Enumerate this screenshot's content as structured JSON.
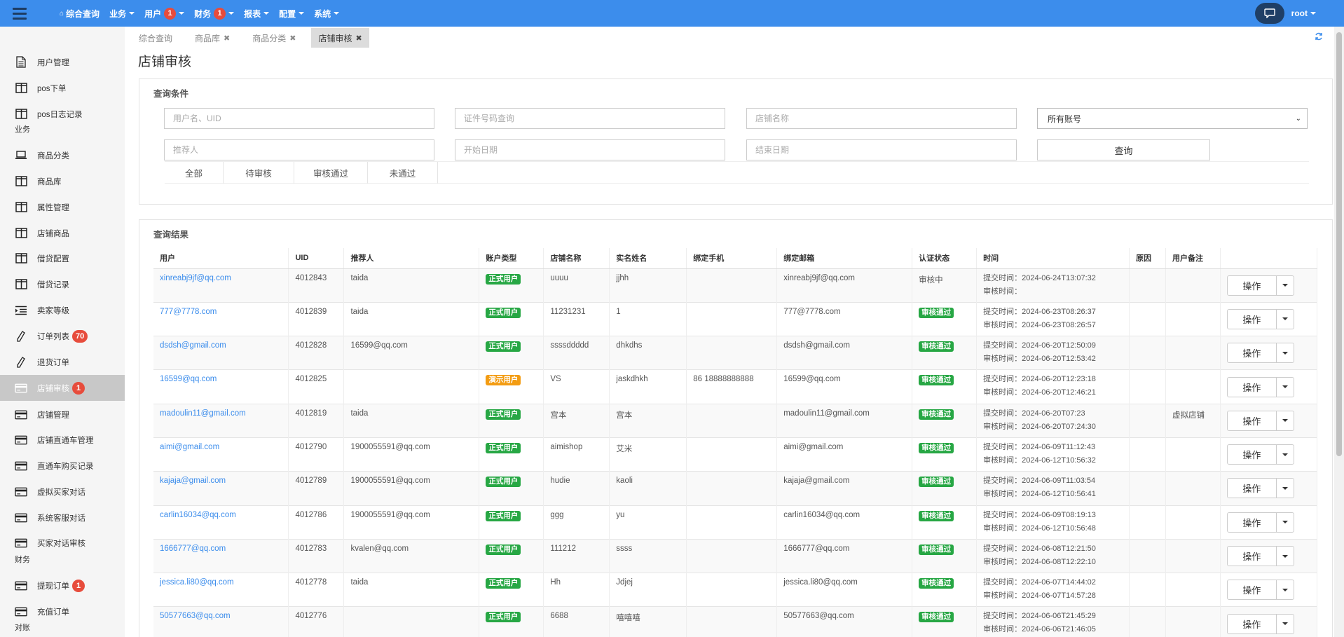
{
  "topnav": {
    "items": [
      {
        "label": "综合查询",
        "home": true,
        "caret": false,
        "badge": null
      },
      {
        "label": "业务",
        "home": false,
        "caret": true,
        "badge": null
      },
      {
        "label": "用户",
        "home": false,
        "caret": true,
        "badge": "1"
      },
      {
        "label": "财务",
        "home": false,
        "caret": true,
        "badge": "1"
      },
      {
        "label": "报表",
        "home": false,
        "caret": true,
        "badge": null
      },
      {
        "label": "配置",
        "home": false,
        "caret": true,
        "badge": null
      },
      {
        "label": "系统",
        "home": false,
        "caret": true,
        "badge": null
      }
    ],
    "user": "root"
  },
  "sidebar": {
    "sections": [
      {
        "label": "业务"
      },
      {
        "label": "财务"
      },
      {
        "label": "对账"
      }
    ],
    "items": [
      {
        "label": "用户管理",
        "icon": "document-icon",
        "badge": null,
        "active": false
      },
      {
        "label": "pos下单",
        "icon": "columns-icon",
        "badge": null,
        "active": false
      },
      {
        "label": "pos日志记录",
        "icon": "columns-icon",
        "badge": null,
        "active": false
      },
      {
        "label": "商品分类",
        "icon": "laptop-icon",
        "badge": null,
        "active": false
      },
      {
        "label": "商品库",
        "icon": "columns-icon",
        "badge": null,
        "active": false
      },
      {
        "label": "属性管理",
        "icon": "columns-icon",
        "badge": null,
        "active": false
      },
      {
        "label": "店铺商品",
        "icon": "columns-icon",
        "badge": null,
        "active": false
      },
      {
        "label": "借贷配置",
        "icon": "columns-icon",
        "badge": null,
        "active": false
      },
      {
        "label": "借贷记录",
        "icon": "columns-icon",
        "badge": null,
        "active": false
      },
      {
        "label": "卖家等级",
        "icon": "indent-icon",
        "badge": null,
        "active": false
      },
      {
        "label": "订单列表",
        "icon": "pencil-icon",
        "badge": "70",
        "active": false
      },
      {
        "label": "退货订单",
        "icon": "pencil-icon",
        "badge": null,
        "active": false
      },
      {
        "label": "店铺审核",
        "icon": "card-icon",
        "badge": "1",
        "active": true
      },
      {
        "label": "店铺管理",
        "icon": "card-icon",
        "badge": null,
        "active": false
      },
      {
        "label": "店铺直通车管理",
        "icon": "card-icon",
        "badge": null,
        "active": false
      },
      {
        "label": "直通车购买记录",
        "icon": "card-icon",
        "badge": null,
        "active": false
      },
      {
        "label": "虚拟买家对话",
        "icon": "card-icon",
        "badge": null,
        "active": false
      },
      {
        "label": "系统客服对话",
        "icon": "card-icon",
        "badge": null,
        "active": false
      },
      {
        "label": "买家对话审核",
        "icon": "card-icon",
        "badge": null,
        "active": false
      },
      {
        "label": "提现订单",
        "icon": "card-icon",
        "badge": "1",
        "active": false
      },
      {
        "label": "充值订单",
        "icon": "card-icon",
        "badge": null,
        "active": false
      }
    ]
  },
  "tabs": [
    {
      "label": "综合查询",
      "closable": false,
      "active": false
    },
    {
      "label": "商品库",
      "closable": true,
      "active": false
    },
    {
      "label": "商品分类",
      "closable": true,
      "active": false
    },
    {
      "label": "店铺审核",
      "closable": true,
      "active": true
    }
  ],
  "page_title": "店铺审核",
  "query": {
    "title": "查询条件",
    "placeholders": {
      "user": "用户名、UID",
      "id_number": "证件号码查询",
      "shop_name": "店铺名称",
      "referrer": "推荐人",
      "start_date": "开始日期",
      "end_date": "结束日期"
    },
    "account_select": "所有账号",
    "query_button": "查询",
    "filter_tabs": [
      "全部",
      "待审核",
      "审核通过",
      "未通过"
    ]
  },
  "results": {
    "title": "查询结果",
    "columns": [
      "用户",
      "UID",
      "推荐人",
      "账户类型",
      "店铺名称",
      "实名姓名",
      "绑定手机",
      "绑定邮箱",
      "认证状态",
      "时间",
      "原因",
      "用户备注",
      ""
    ],
    "submit_prefix": "提交时间：",
    "review_prefix": "审核时间：",
    "action_label": "操作",
    "rows": [
      {
        "user": "xinreabj9jf@qq.com",
        "uid": "4012843",
        "referrer": "taida",
        "account_type": "正式用户",
        "account_color": "green",
        "shop": "uuuu",
        "real_name": "jjhh",
        "phone": "",
        "email": "xinreabj9jf@qq.com",
        "status": "审核中",
        "status_pill": false,
        "submit_time": "2024-06-24T13:07:32",
        "review_time": "",
        "reason": "",
        "remark": ""
      },
      {
        "user": "777@7778.com",
        "uid": "4012839",
        "referrer": "taida",
        "account_type": "正式用户",
        "account_color": "green",
        "shop": "11231231",
        "real_name": "1",
        "phone": "",
        "email": "777@7778.com",
        "status": "审核通过",
        "status_pill": true,
        "submit_time": "2024-06-23T08:26:37",
        "review_time": "2024-06-23T08:26:57",
        "reason": "",
        "remark": ""
      },
      {
        "user": "dsdsh@gmail.com",
        "uid": "4012828",
        "referrer": "16599@qq.com",
        "account_type": "正式用户",
        "account_color": "green",
        "shop": "ssssddddd",
        "real_name": "dhkdhs",
        "phone": "",
        "email": "dsdsh@gmail.com",
        "status": "审核通过",
        "status_pill": true,
        "submit_time": "2024-06-20T12:50:09",
        "review_time": "2024-06-20T12:53:42",
        "reason": "",
        "remark": ""
      },
      {
        "user": "16599@qq.com",
        "uid": "4012825",
        "referrer": "",
        "account_type": "演示用户",
        "account_color": "orange",
        "shop": "VS",
        "real_name": "jaskdhkh",
        "phone": "86 18888888888",
        "email": "16599@qq.com",
        "status": "审核通过",
        "status_pill": true,
        "submit_time": "2024-06-20T12:23:18",
        "review_time": "2024-06-20T12:46:21",
        "reason": "",
        "remark": ""
      },
      {
        "user": "madoulin11@gmail.com",
        "uid": "4012819",
        "referrer": "taida",
        "account_type": "正式用户",
        "account_color": "green",
        "shop": "宫本",
        "real_name": "宫本",
        "phone": "",
        "email": "madoulin11@gmail.com",
        "status": "审核通过",
        "status_pill": true,
        "submit_time": "2024-06-20T07:23",
        "review_time": "2024-06-20T07:24:30",
        "reason": "",
        "remark": "虚拟店铺"
      },
      {
        "user": "aimi@gmail.com",
        "uid": "4012790",
        "referrer": "1900055591@qq.com",
        "account_type": "正式用户",
        "account_color": "green",
        "shop": "aimishop",
        "real_name": "艾米",
        "phone": "",
        "email": "aimi@gmail.com",
        "status": "审核通过",
        "status_pill": true,
        "submit_time": "2024-06-09T11:12:43",
        "review_time": "2024-06-12T10:56:32",
        "reason": "",
        "remark": ""
      },
      {
        "user": "kajaja@gmail.com",
        "uid": "4012789",
        "referrer": "1900055591@qq.com",
        "account_type": "正式用户",
        "account_color": "green",
        "shop": "hudie",
        "real_name": "kaoli",
        "phone": "",
        "email": "kajaja@gmail.com",
        "status": "审核通过",
        "status_pill": true,
        "submit_time": "2024-06-09T11:03:54",
        "review_time": "2024-06-12T10:56:41",
        "reason": "",
        "remark": ""
      },
      {
        "user": "carlin16034@qq.com",
        "uid": "4012786",
        "referrer": "1900055591@qq.com",
        "account_type": "正式用户",
        "account_color": "green",
        "shop": "ggg",
        "real_name": "yu",
        "phone": "",
        "email": "carlin16034@qq.com",
        "status": "审核通过",
        "status_pill": true,
        "submit_time": "2024-06-09T08:19:13",
        "review_time": "2024-06-12T10:56:48",
        "reason": "",
        "remark": ""
      },
      {
        "user": "1666777@qq.com",
        "uid": "4012783",
        "referrer": "kvalen@qq.com",
        "account_type": "正式用户",
        "account_color": "green",
        "shop": "111212",
        "real_name": "ssss",
        "phone": "",
        "email": "1666777@qq.com",
        "status": "审核通过",
        "status_pill": true,
        "submit_time": "2024-06-08T12:21:50",
        "review_time": "2024-06-08T12:22:10",
        "reason": "",
        "remark": ""
      },
      {
        "user": "jessica.li80@qq.com",
        "uid": "4012778",
        "referrer": "taida",
        "account_type": "正式用户",
        "account_color": "green",
        "shop": "Hh",
        "real_name": "Jdjej",
        "phone": "",
        "email": "jessica.li80@qq.com",
        "status": "审核通过",
        "status_pill": true,
        "submit_time": "2024-06-07T14:44:02",
        "review_time": "2024-06-07T14:57:28",
        "reason": "",
        "remark": ""
      },
      {
        "user": "50577663@qq.com",
        "uid": "4012776",
        "referrer": "",
        "account_type": "正式用户",
        "account_color": "green",
        "shop": "6688",
        "real_name": "嘻嘻嘻",
        "phone": "",
        "email": "50577663@qq.com",
        "status": "审核通过",
        "status_pill": true,
        "submit_time": "2024-06-06T21:45:29",
        "review_time": "2024-06-06T21:46:05",
        "reason": "",
        "remark": ""
      }
    ]
  },
  "colors": {
    "topbar": "#3c8dec",
    "link": "#3c8dec",
    "badge": "#e74c3c",
    "pill_green": "#27a744",
    "pill_orange": "#f39c12"
  }
}
